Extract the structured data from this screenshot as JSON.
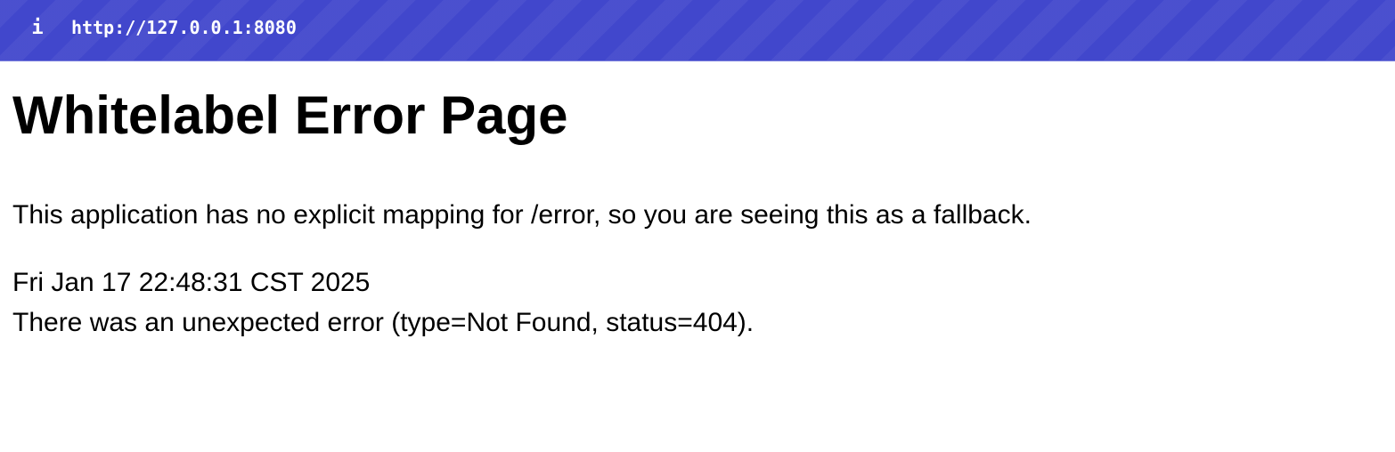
{
  "url_bar": {
    "icon": "info-icon",
    "icon_glyph": "i",
    "url": "http://127.0.0.1:8080",
    "background_color": "#4147cc"
  },
  "page": {
    "title": "Whitelabel Error Page",
    "explanation": "This application has no explicit mapping for /error, so you are seeing this as a fallback.",
    "timestamp": "Fri Jan 17 22:48:31 CST 2025",
    "error_detail": "There was an unexpected error (type=Not Found, status=404)."
  }
}
